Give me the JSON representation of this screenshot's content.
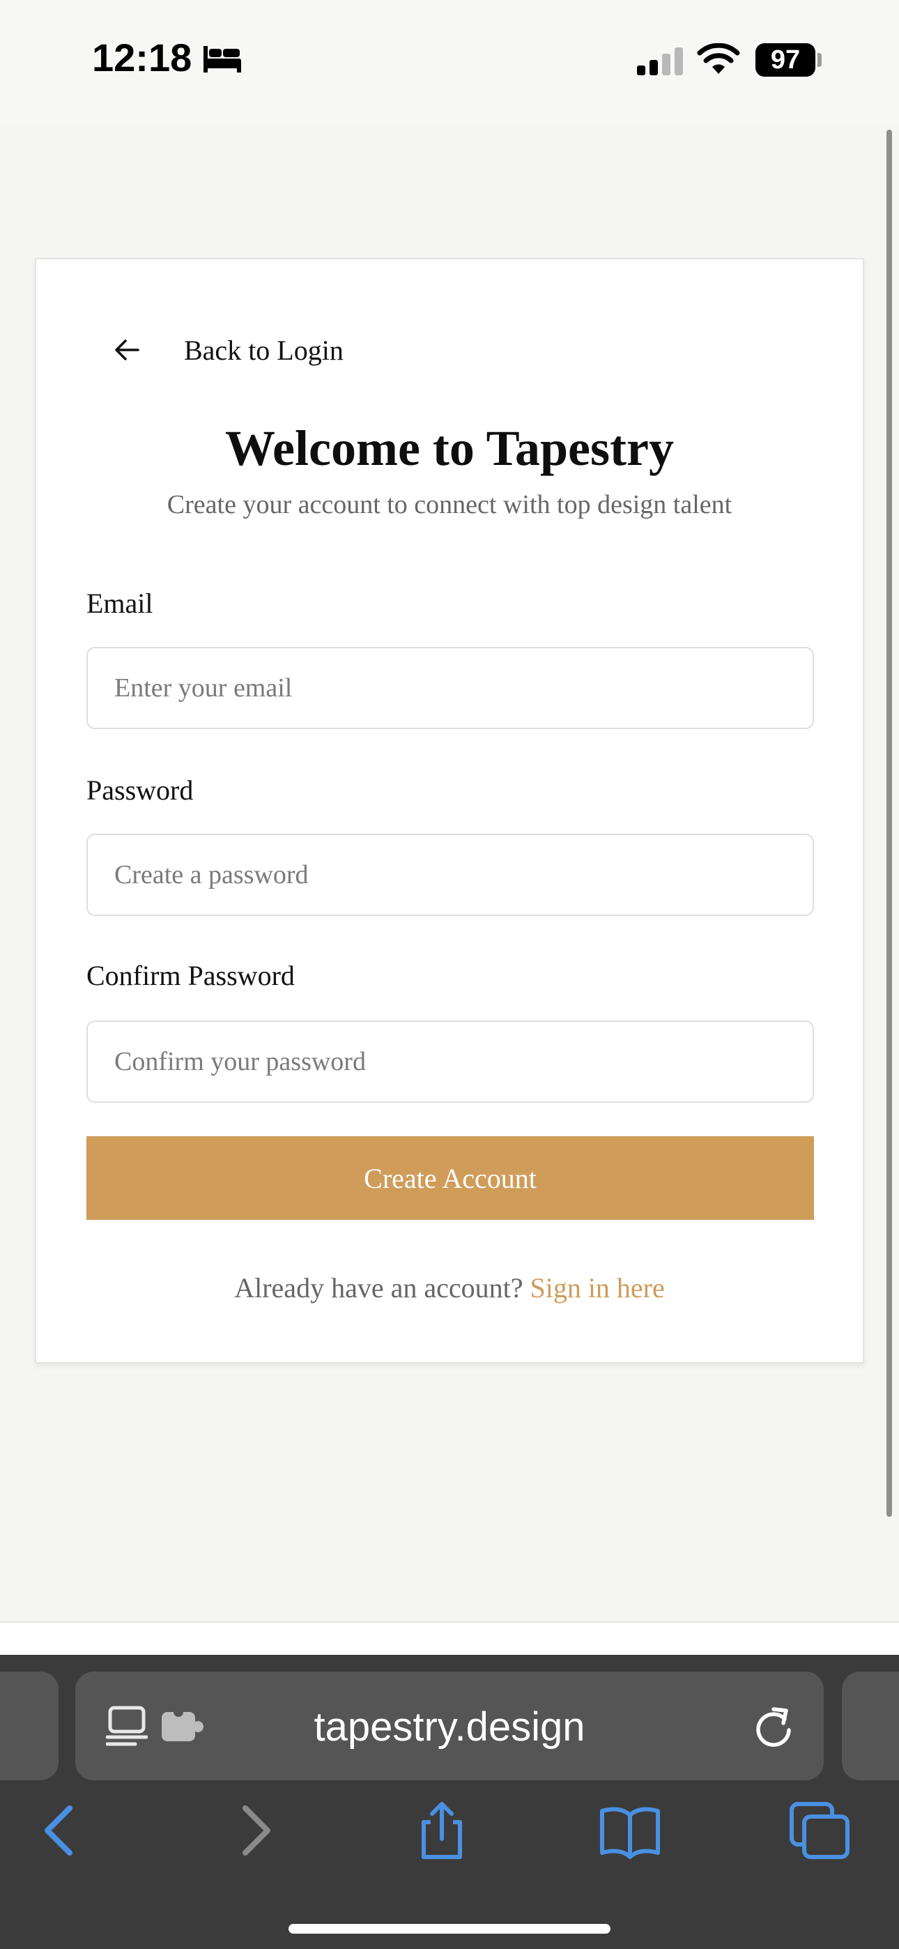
{
  "status_bar": {
    "time": "12:18",
    "battery": "97",
    "icons": [
      "bed-icon",
      "signal-icon",
      "wifi-icon",
      "battery-icon"
    ]
  },
  "card": {
    "back_label": "Back to Login",
    "title": "Welcome to Tapestry",
    "subtitle": "Create your account to connect with top design talent",
    "email": {
      "label": "Email",
      "placeholder": "Enter your email",
      "value": ""
    },
    "password": {
      "label": "Password",
      "placeholder": "Create a password",
      "value": ""
    },
    "confirm_password": {
      "label": "Confirm Password",
      "placeholder": "Confirm your password",
      "value": ""
    },
    "create_button": "Create Account",
    "signin_prompt": "Already have an account?",
    "signin_link": "Sign in here"
  },
  "browser": {
    "url": "tapestry.design",
    "icons": [
      "reader-icon",
      "extension-icon",
      "reload-icon",
      "back-icon",
      "forward-icon",
      "share-icon",
      "bookmarks-icon",
      "tabs-icon"
    ]
  },
  "colors": {
    "accent": "#cf9c5a",
    "page_background": "#f5f5f3",
    "toolbar": "#3b3b3b",
    "ios_blue": "#4a90e2"
  }
}
